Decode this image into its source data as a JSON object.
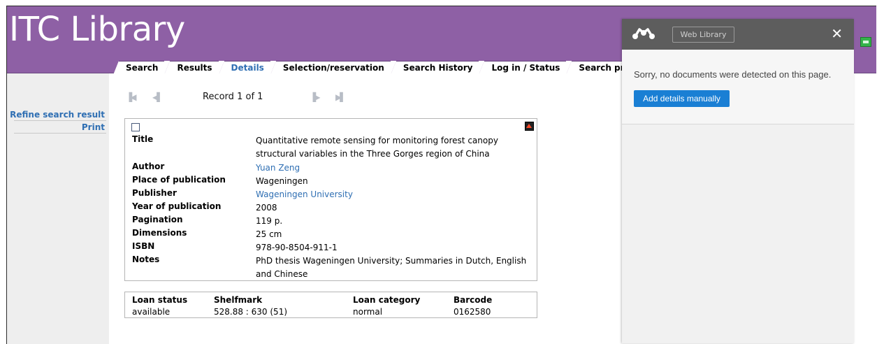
{
  "app": {
    "title": "ITC Library"
  },
  "tabs": [
    {
      "label": "Search",
      "active": false
    },
    {
      "label": "Results",
      "active": false
    },
    {
      "label": "Details",
      "active": true
    },
    {
      "label": "Selection/reservation",
      "active": false
    },
    {
      "label": "Search History",
      "active": false
    },
    {
      "label": "Log in / Status",
      "active": false
    },
    {
      "label": "Search profiles",
      "active": false
    }
  ],
  "sidebar": {
    "items": [
      {
        "label": "Refine search result"
      },
      {
        "label": "Print"
      }
    ]
  },
  "record_nav": {
    "record_label": "Record",
    "current": "1",
    "of_label": "of",
    "total": "1"
  },
  "record": {
    "fields": [
      {
        "label": "Title",
        "value": "Quantitative remote sensing for monitoring forest canopy",
        "value2": "structural variables in the Three Gorges region of China"
      },
      {
        "label": "Author",
        "value": "Yuan Zeng"
      },
      {
        "label": "Place of publication",
        "value": "Wageningen"
      },
      {
        "label": "Publisher",
        "value": "Wageningen University"
      },
      {
        "label": "Year of publication",
        "value": "2008"
      },
      {
        "label": "Pagination",
        "value": "119 p."
      },
      {
        "label": "Dimensions",
        "value": "25 cm"
      },
      {
        "label": "ISBN",
        "value": "978-90-8504-911-1"
      },
      {
        "label": "Notes",
        "value": "PhD thesis Wageningen University; Summaries in Dutch, English",
        "value2": "and Chinese"
      }
    ]
  },
  "loan": {
    "headers": [
      "Loan status",
      "Shelfmark",
      "Loan category",
      "Barcode"
    ],
    "values": [
      "available",
      "528.88 : 630 (51)",
      "normal",
      "0162580"
    ]
  },
  "panel": {
    "web_library_label": "Web Library",
    "close_label": "✕",
    "message": "Sorry, no documents were detected on this page.",
    "add_button_label": "Add details manually"
  },
  "colors": {
    "header_bg": "#8e60a5",
    "link": "#2f6fb3",
    "add_button": "#1a7fd4",
    "panel_head": "#5d5d5d"
  },
  "icons": {
    "first": "first-record-icon",
    "prev": "previous-record-icon",
    "next": "next-record-icon",
    "last": "last-record-icon",
    "checkbox": "select-checkbox",
    "corner": "home-icon",
    "indicator": "green-indicator-icon",
    "logo": "mendeley-logo-icon"
  }
}
